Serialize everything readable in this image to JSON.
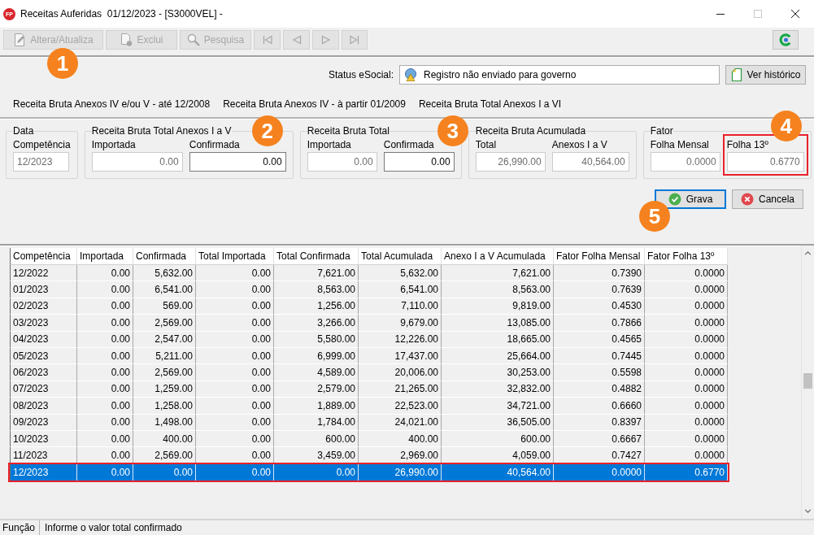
{
  "window": {
    "logo_text": "FP",
    "title": "Receitas Auferidas  01/12/2023 - [S3000VEL] -"
  },
  "toolbar": {
    "buttons": [
      {
        "kind": "edit",
        "label": "Altera/Atualiza",
        "disabled": true,
        "marker": "1"
      },
      {
        "kind": "delete",
        "label": "Exclui",
        "disabled": true
      },
      {
        "kind": "search",
        "label": "Pesquisa",
        "disabled": true
      },
      {
        "kind": "first",
        "disabled": true
      },
      {
        "kind": "previous",
        "disabled": true
      },
      {
        "kind": "next",
        "disabled": true
      },
      {
        "kind": "last",
        "disabled": true
      }
    ]
  },
  "esocial": {
    "label": "Status eSocial:",
    "value": "Registro não enviado para governo",
    "history_button": "Ver histórico"
  },
  "tabs": [
    {
      "label": "Receita Bruta Anexos IV e/ou V - até 12/2008"
    },
    {
      "label": "Receita Bruta Anexos IV - à partir 01/2009"
    },
    {
      "label": "Receita Bruta Total Anexos I a VI"
    }
  ],
  "groups": [
    {
      "title": "Data",
      "fields": [
        {
          "kind": "date",
          "label": "Competência",
          "value": "12/2023",
          "disabled": true,
          "highlighted": false
        }
      ]
    },
    {
      "title": "Receita Bruta Total Anexos I a V",
      "fields": [
        {
          "kind": "amount",
          "label": "Importada",
          "value": "0.00",
          "disabled": true,
          "highlighted": false
        },
        {
          "kind": "amount",
          "label": "Confirmada",
          "value": "0.00",
          "disabled": false,
          "highlighted": false,
          "marker": "2"
        }
      ]
    },
    {
      "title": "Receita Bruta Total",
      "fields": [
        {
          "kind": "amount",
          "label": "Importada",
          "value": "0.00",
          "disabled": true,
          "highlighted": false
        },
        {
          "kind": "amount",
          "label": "Confirmada",
          "value": "0.00",
          "disabled": false,
          "highlighted": false,
          "marker": "3"
        }
      ]
    },
    {
      "title": "Receita Bruta Acumulada",
      "fields": [
        {
          "kind": "amount",
          "label": "Total",
          "value": "26,990.00",
          "disabled": true,
          "highlighted": false
        },
        {
          "kind": "amount",
          "label": "Anexos I a V",
          "value": "40,564.00",
          "disabled": true,
          "highlighted": false
        }
      ]
    },
    {
      "title": "Fator",
      "fields": [
        {
          "kind": "amount",
          "label": "Folha Mensal",
          "value": "0.0000",
          "disabled": true,
          "highlighted": false
        },
        {
          "kind": "amount",
          "label": "Folha 13º",
          "value": "0.6770",
          "disabled": true,
          "highlighted": true,
          "marker": "4"
        }
      ]
    }
  ],
  "actions": [
    {
      "kind": "save",
      "label": "Grava",
      "focused": true,
      "marker": "5"
    },
    {
      "kind": "cancel",
      "label": "Cancela",
      "focused": false
    }
  ],
  "table": {
    "columns": [
      "Competência",
      "Importada",
      "Confirmada",
      "Total Importada",
      "Total Confirmada",
      "Total Acumulada",
      "Anexo I a V Acumulada",
      "Fator Folha Mensal",
      "Fator Folha 13º"
    ],
    "rows": [
      {
        "cells": [
          "12/2022",
          "0.00",
          "5,632.00",
          "0.00",
          "7,621.00",
          "5,632.00",
          "7,621.00",
          "0.7390",
          "0.0000"
        ],
        "selected": false,
        "highlighted": false
      },
      {
        "cells": [
          "01/2023",
          "0.00",
          "6,541.00",
          "0.00",
          "8,563.00",
          "6,541.00",
          "8,563.00",
          "0.7639",
          "0.0000"
        ],
        "selected": false,
        "highlighted": false
      },
      {
        "cells": [
          "02/2023",
          "0.00",
          "569.00",
          "0.00",
          "1,256.00",
          "7,110.00",
          "9,819.00",
          "0.4530",
          "0.0000"
        ],
        "selected": false,
        "highlighted": false
      },
      {
        "cells": [
          "03/2023",
          "0.00",
          "2,569.00",
          "0.00",
          "3,266.00",
          "9,679.00",
          "13,085.00",
          "0.7866",
          "0.0000"
        ],
        "selected": false,
        "highlighted": false
      },
      {
        "cells": [
          "04/2023",
          "0.00",
          "2,547.00",
          "0.00",
          "5,580.00",
          "12,226.00",
          "18,665.00",
          "0.4565",
          "0.0000"
        ],
        "selected": false,
        "highlighted": false
      },
      {
        "cells": [
          "05/2023",
          "0.00",
          "5,211.00",
          "0.00",
          "6,999.00",
          "17,437.00",
          "25,664.00",
          "0.7445",
          "0.0000"
        ],
        "selected": false,
        "highlighted": false
      },
      {
        "cells": [
          "06/2023",
          "0.00",
          "2,569.00",
          "0.00",
          "4,589.00",
          "20,006.00",
          "30,253.00",
          "0.5598",
          "0.0000"
        ],
        "selected": false,
        "highlighted": false
      },
      {
        "cells": [
          "07/2023",
          "0.00",
          "1,259.00",
          "0.00",
          "2,579.00",
          "21,265.00",
          "32,832.00",
          "0.4882",
          "0.0000"
        ],
        "selected": false,
        "highlighted": false
      },
      {
        "cells": [
          "08/2023",
          "0.00",
          "1,258.00",
          "0.00",
          "1,889.00",
          "22,523.00",
          "34,721.00",
          "0.6660",
          "0.0000"
        ],
        "selected": false,
        "highlighted": false
      },
      {
        "cells": [
          "09/2023",
          "0.00",
          "1,498.00",
          "0.00",
          "1,784.00",
          "24,021.00",
          "36,505.00",
          "0.8397",
          "0.0000"
        ],
        "selected": false,
        "highlighted": false
      },
      {
        "cells": [
          "10/2023",
          "0.00",
          "400.00",
          "0.00",
          "600.00",
          "400.00",
          "600.00",
          "0.6667",
          "0.0000"
        ],
        "selected": false,
        "highlighted": false
      },
      {
        "cells": [
          "11/2023",
          "0.00",
          "2,569.00",
          "0.00",
          "3,459.00",
          "2,969.00",
          "4,059.00",
          "0.7427",
          "0.0000"
        ],
        "selected": false,
        "highlighted": false
      },
      {
        "cells": [
          "12/2023",
          "0.00",
          "0.00",
          "0.00",
          "0.00",
          "26,990.00",
          "40,564.00",
          "0.0000",
          "0.6770"
        ],
        "selected": true,
        "highlighted": true
      }
    ]
  },
  "status_bar": {
    "section": "Função",
    "message": "Informe o valor total confirmado"
  }
}
